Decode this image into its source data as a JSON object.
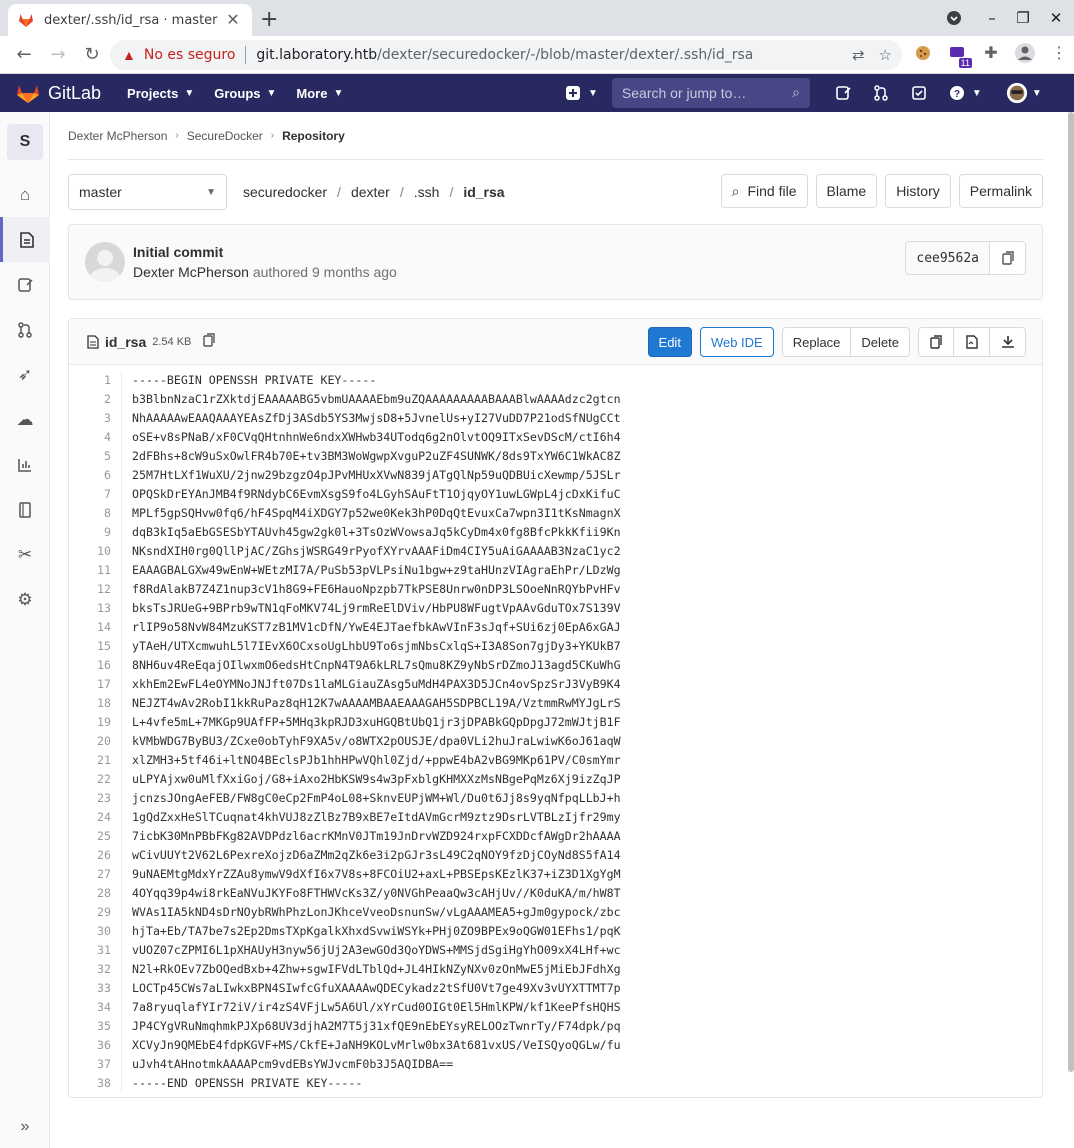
{
  "browser": {
    "tab_title": "dexter/.ssh/id_rsa · master",
    "security_label": "No es seguro",
    "url_host": "git.laboratory.htb",
    "url_path": "/dexter/securedocker/-/blob/master/dexter/.ssh/id_rsa",
    "extension_badge": "11"
  },
  "gitlab": {
    "brand": "GitLab",
    "nav": {
      "projects": "Projects",
      "groups": "Groups",
      "more": "More"
    },
    "search_placeholder": "Search or jump to…",
    "project_initial": "S"
  },
  "breadcrumb": {
    "user": "Dexter McPherson",
    "project": "SecureDocker",
    "current": "Repository"
  },
  "toolbar": {
    "branch": "master",
    "path": [
      "securedocker",
      "dexter",
      ".ssh"
    ],
    "file": "id_rsa",
    "find_file": "Find file",
    "blame": "Blame",
    "history": "History",
    "permalink": "Permalink"
  },
  "commit": {
    "message": "Initial commit",
    "author": "Dexter McPherson",
    "authored": "authored",
    "time": "9 months ago",
    "sha": "cee9562a"
  },
  "file": {
    "name": "id_rsa",
    "size": "2.54 KB",
    "edit": "Edit",
    "web_ide": "Web IDE",
    "replace": "Replace",
    "delete": "Delete",
    "lines": [
      "-----BEGIN OPENSSH PRIVATE KEY-----",
      "b3BlbnNzaC1rZXktdjEAAAAABG5vbmUAAAAEbm9uZQAAAAAAAAABAAABlwAAAAdzc2gtcn",
      "NhAAAAAwEAAQAAAYEAsZfDj3ASdb5YS3MwjsD8+5JvnelUs+yI27VuDD7P21odSfNUgCCt",
      "oSE+v8sPNaB/xF0CVqQHtnhnWe6ndxXWHwb34UTodq6g2nOlvtOQ9ITxSevDScM/ctI6h4",
      "2dFBhs+8cW9uSxOwlFR4b70E+tv3BM3WoWgwpXvguP2uZF4SUNWK/8ds9TxYW6C1WkAC8Z",
      "25M7HtLXf1WuXU/2jnw29bzgzO4pJPvMHUxXVwN839jATgQlNp59uQDBUicXewmp/5JSLr",
      "OPQSkDrEYAnJMB4f9RNdybC6EvmXsgS9fo4LGyhSAuFtT1OjqyOY1uwLGWpL4jcDxKifuC",
      "MPLf5gpSQHvw0fq6/hF4SpqM4iXDGY7p52we0Kek3hP0DqQtEvuxCa7wpn3I1tKsNmagnX",
      "dqB3kIq5aEbGSESbYTAUvh45gw2gk0l+3TsOzWVowsaJq5kCyDm4x0fg8BfcPkkKfii9Kn",
      "NKsndXIH0rg0QllPjAC/ZGhsjWSRG49rPyofXYrvAAAFiDm4CIY5uAiGAAAAB3NzaC1yc2",
      "EAAAGBALGXw49wEnW+WEtzMI7A/PuSb53pVLPsiNu1bgw+z9taHUnzVIAgraEhPr/LDzWg",
      "f8RdAlakB7Z4Z1nup3cV1h8G9+FE6HauoNpzpb7TkPSE8Unrw0nDP3LSOoeNnRQYbPvHFv",
      "bksTsJRUeG+9BPrb9wTN1qFoMKV74Lj9rmReElDViv/HbPU8WFugtVpAAvGduTOx7S139V",
      "rlIP9o58NvW84MzuKST7zB1MV1cDfN/YwE4EJTaefbkAwVInF3sJqf+SUi6zj0EpA6xGAJ",
      "yTAeH/UTXcmwuhL5l7IEvX6OCxsoUgLhbU9To6sjmNbsCxlqS+I3A8Son7gjDy3+YKUkB7",
      "8NH6uv4ReEqajOIlwxmO6edsHtCnpN4T9A6kLRL7sQmu8KZ9yNbSrDZmoJ13agd5CKuWhG",
      "xkhEm2EwFL4eOYMNoJNJft07Ds1laMLGiauZAsg5uMdH4PAX3D5JCn4ovSpzSrJ3VyB9K4",
      "NEJZT4wAv2RobI1kkRuPaz8qH12K7wAAAAMBAAEAAAGAH5SDPBCL19A/VztmmRwMYJgLrS",
      "L+4vfe5mL+7MKGp9UAfFP+5MHq3kpRJD3xuHGQBtUbQ1jr3jDPABkGQpDpgJ72mWJtjB1F",
      "kVMbWDG7ByBU3/ZCxe0obTyhF9XA5v/o8WTX2pOUSJE/dpa0VLi2huJraLwiwK6oJ61aqW",
      "xlZMH3+5tf46i+ltNO4BEclsPJb1hhHPwVQhl0Zjd/+ppwE4bA2vBG9MKp61PV/C0smYmr",
      "uLPYAjxw0uMlfXxiGoj/G8+iAxo2HbKSW9s4w3pFxblgKHMXXzMsNBgePqMz6Xj9izZqJP",
      "jcnzsJOngAeFEB/FW8gC0eCp2FmP4oL08+SknvEUPjWM+Wl/Du0t6Jj8s9yqNfpqLLbJ+h",
      "1gQdZxxHeSlTCuqnat4khVUJ8zZlBz7B9xBE7eItdAVmGcrM9ztz9DsrLVTBLzIjfr29my",
      "7icbK30MnPBbFKg82AVDPdzl6acrKMnV0JTm19JnDrvWZD924rxpFCXDDcfAWgDr2hAAAA",
      "wCivUUYt2V62L6PexreXojzD6aZMm2qZk6e3i2pGJr3sL49C2qNOY9fzDjCOyNd8S5fA14",
      "9uNAEMtgMdxYrZZAu8ymwV9dXfI6x7V8s+8FCOiU2+axL+PBSEpsKEzlK37+iZ3D1XgYgM",
      "4OYqq39p4wi8rkEaNVuJKYFo8FTHWVcKs3Z/y0NVGhPeaaQw3cAHjUv//K0duKA/m/hW8T",
      "WVAs1IA5kND4sDrNOybRWhPhzLonJKhceVveoDsnunSw/vLgAAAMEA5+gJm0gypock/zbc",
      "hjTa+Eb/TA7be7s2Ep2DmsTXpKgalkXhxdSvwiWSYk+PHj0ZO9BPEx9oQGW01EFhs1/pqK",
      "vUOZ07cZPMI6L1pXHAUyH3nyw56jUj2A3ewGOd3QoYDWS+MMSjdSgiHgYhO09xX4LHf+wc",
      "N2l+RkOEv7ZbOQedBxb+4Zhw+sgwIFVdLTblQd+JL4HIkNZyNXv0zOnMwE5jMiEbJFdhXg",
      "LOCTp45CWs7aLIwkxBPN4SIwfcGfuXAAAAwQDECykadz2tSfU0Vt7ge49Xv3vUYXTTMT7p",
      "7a8ryuqlafYIr72iV/ir4zS4VFjLw5A6Ul/xYrCud0OIGt0El5HmlKPW/kf1KeePfsHQHS",
      "JP4CYgVRuNmqhmkPJXp68UV3djhA2M7T5j31xfQE9nEbEYsyRELOOzTwnrTy/F74dpk/pq",
      "XCVyJn9QMEbE4fdpKGVF+MS/CkfE+JaNH9KOLvMrlw0bx3At681vxUS/VeISQyoQGLw/fu",
      "uJvh4tAHnotmkAAAAPcm9vdEBsYWJvcmF0b3J5AQIDBA==",
      "-----END OPENSSH PRIVATE KEY-----"
    ]
  },
  "colors": {
    "gitlab_header": "#292961",
    "primary": "#1f78d1",
    "insecure": "#c5221f"
  }
}
